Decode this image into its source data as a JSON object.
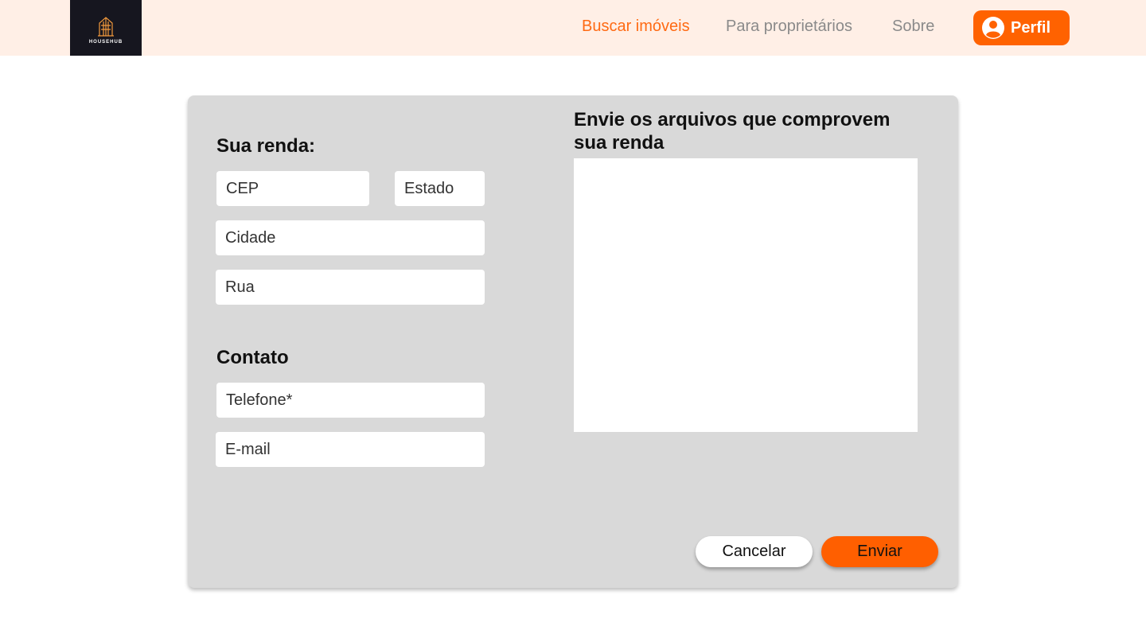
{
  "header": {
    "logo_text": "HOUSEHUB",
    "nav": {
      "buscar": "Buscar imóveis",
      "proprietarios": "Para proprietários",
      "sobre": "Sobre"
    },
    "profile_label": "Perfil"
  },
  "form": {
    "renda_title": "Sua renda:",
    "cep_placeholder": "CEP",
    "estado_placeholder": "Estado",
    "cidade_placeholder": "Cidade",
    "rua_placeholder": "Rua",
    "contato_title": "Contato",
    "telefone_placeholder": "Telefone*",
    "email_placeholder": "E-mail"
  },
  "upload": {
    "title": "Envie os arquivos que comprovem sua renda"
  },
  "actions": {
    "cancel_label": "Cancelar",
    "send_label": "Enviar"
  },
  "colors": {
    "accent": "#ff6200",
    "active_link": "#ff6a13",
    "header_bg": "#ffefe6",
    "card_bg": "#d9d9d9",
    "logo_bg": "#16161f"
  },
  "icons": {
    "logo": "building-logo-icon",
    "profile": "user-circle-icon"
  }
}
